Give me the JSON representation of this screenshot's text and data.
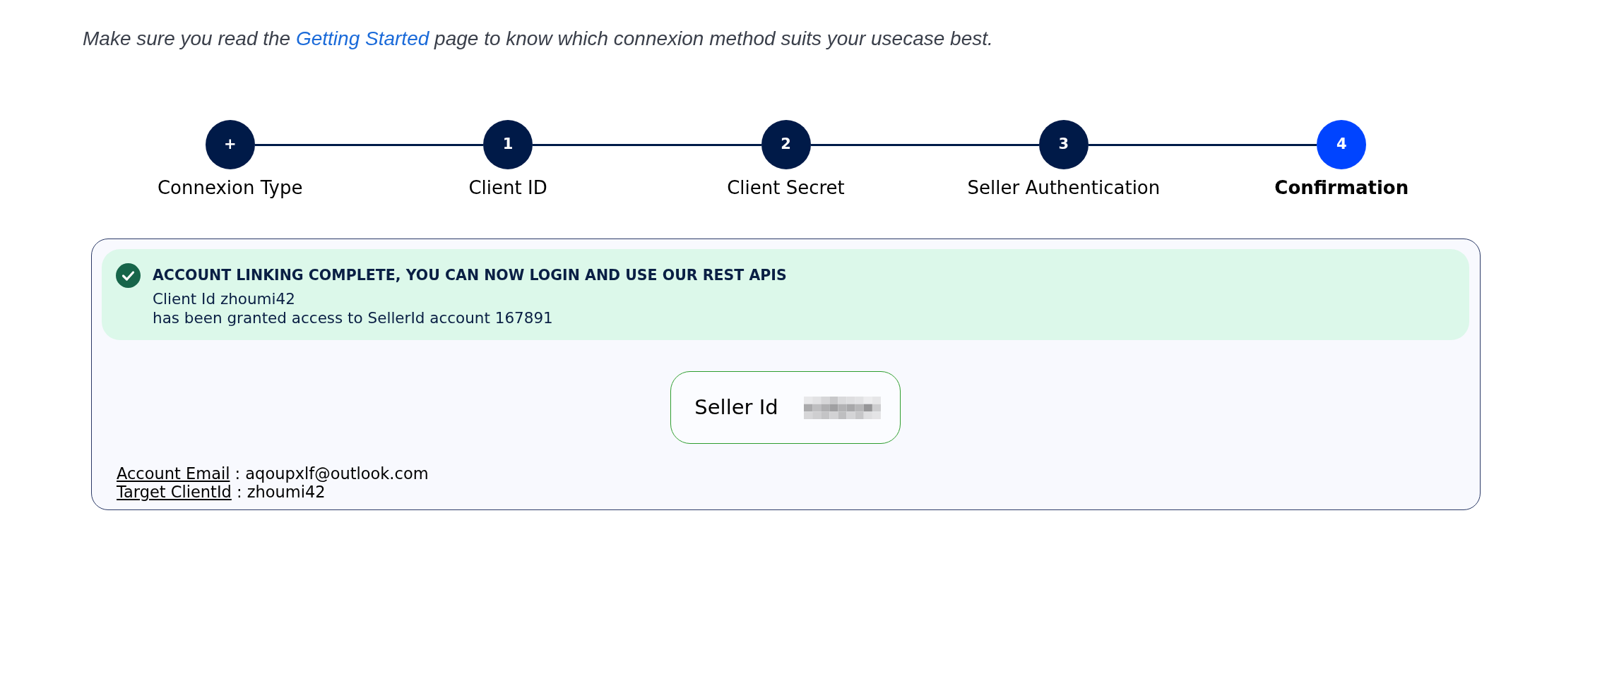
{
  "intro": {
    "text_before": "Make sure you read the",
    "link": "Getting Started",
    "text_after": "page to know which connexion method suits your usecase best."
  },
  "stepper": {
    "steps": [
      {
        "marker": "+",
        "label": "Connexion Type",
        "selected": false
      },
      {
        "marker": "1",
        "label": "Client ID",
        "selected": false
      },
      {
        "marker": "2",
        "label": "Client Secret",
        "selected": false
      },
      {
        "marker": "3",
        "label": "Seller Authentication",
        "selected": false
      },
      {
        "marker": "4",
        "label": "Confirmation",
        "selected": true
      }
    ]
  },
  "result": {
    "alert": {
      "title": "ACCOUNT LINKING COMPLETE, YOU CAN NOW LOGIN AND USE OUR REST APIS",
      "lines": [
        "Client Id zhoumi42",
        "has been granted access to SellerId account 167891"
      ]
    },
    "seller_id": {
      "label": "Seller Id",
      "redacted": true
    },
    "details": [
      {
        "label": "Account Email",
        "value": ": aqoupxlf@outlook.com"
      },
      {
        "label": "Target ClientId",
        "value": ": zhoumi42"
      }
    ]
  }
}
